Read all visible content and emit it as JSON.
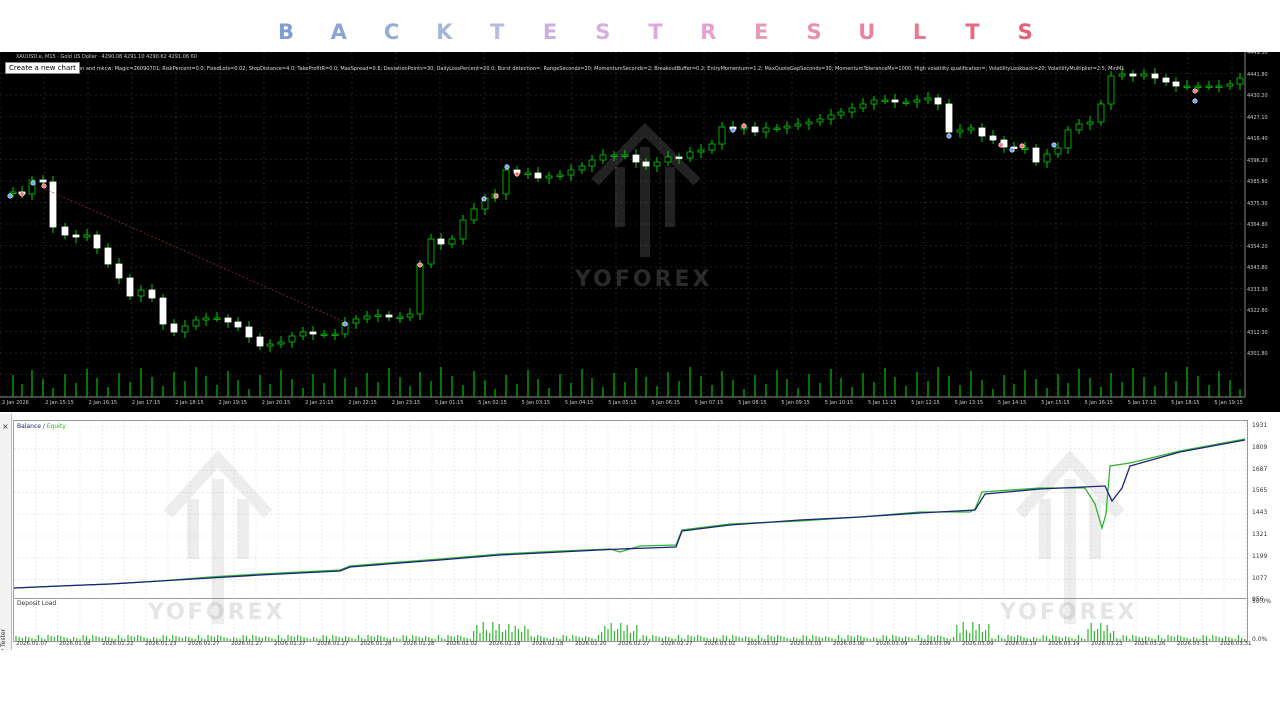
{
  "banner": {
    "letters": [
      "B",
      "A",
      "C",
      "K",
      "T",
      "E",
      "S",
      "T",
      "R",
      "E",
      "S",
      "U",
      "L",
      "T",
      "S"
    ],
    "colors": [
      "#7e9ed4",
      "#8aa4d6",
      "#95acd9",
      "#a6b5dc",
      "#b9b9e2",
      "#c8b0e0",
      "#d6aee0",
      "#e0a8d6",
      "#e6a2cc",
      "#e69ab8",
      "#e890ac",
      "#e8849e",
      "#e87890",
      "#e66c82",
      "#e46076"
    ]
  },
  "chart": {
    "header": "XAUUSD.e, M15 · Gold US Dollar · 4290.08 4291.10 4290.62 4291.06  60",
    "params": "on and mkcw; Magic=26090701; RiskPercent=0.0; FixedLots=0.02; StopDistance=4.0; TakeProfitR=0.0; MaxSpread=0.6; DeviationPoints=30; DailyLossPercent=20.0; Burst detection=; RangeSeconds=20; MomentumSeconds=2; BreakoutBuffer=0.2; EntryMomentum=1.2; MaxQuoteGapSeconds=30; MomentumToleranceMs=1000; High volatility qualification=; VolatilityLookback=20; VolatilityMultiplier=2.5; MinM1",
    "tooltip": "Create a new chart",
    "price_labels": [
      "4449.30",
      "4441.80",
      "4430.20",
      "4427.10",
      "4416.40",
      "4396.20",
      "4385.80",
      "4375.30",
      "4364.80",
      "4354.20",
      "4343.80",
      "4333.30",
      "4322.80",
      "4312.30",
      "4301.80"
    ],
    "time_labels": [
      "2 Jan 2026",
      "2 Jan 15:15",
      "2 Jan 16:15",
      "2 Jan 17:15",
      "2 Jan 18:15",
      "2 Jan 19:15",
      "2 Jan 20:15",
      "2 Jan 21:15",
      "2 Jan 22:15",
      "2 Jan 23:15",
      "5 Jan 01:15",
      "5 Jan 02:15",
      "5 Jan 03:15",
      "5 Jan 04:15",
      "5 Jan 05:15",
      "5 Jan 06:15",
      "5 Jan 07:15",
      "5 Jan 08:15",
      "5 Jan 09:15",
      "5 Jan 10:15",
      "5 Jan 11:15",
      "5 Jan 12:15",
      "5 Jan 13:15",
      "5 Jan 14:15",
      "5 Jan 15:15",
      "5 Jan 16:15",
      "5 Jan 17:15",
      "5 Jan 18:15",
      "5 Jan 19:15"
    ],
    "watermark": "YOFOREX",
    "colors": {
      "bull": "#ffffff",
      "bear": "#ffffff",
      "wick": "#00d000",
      "grid": "#3a3a3a",
      "volume": "#00c000"
    }
  },
  "tester": {
    "side_label": "Strategy Tester",
    "close_glyph": "×",
    "balance_legend": {
      "balance": "Balance",
      "sep": " / ",
      "equity": "Equity"
    },
    "deposit_title": "Deposit Load",
    "y_labels": [
      "1931",
      "1809",
      "1687",
      "1565",
      "1443",
      "1321",
      "1199",
      "1077",
      "956"
    ],
    "deposit_labels": [
      "50.0%",
      "0.0%"
    ],
    "date_labels": [
      "2026.01.07",
      "2026.01.08",
      "2026.01.22",
      "2026.01.23",
      "2026.01.27",
      "2026.01.27",
      "2026.01.27",
      "2026.01.27",
      "2026.01.28",
      "2026.01.28",
      "2026.02.02",
      "2026.02.18",
      "2026.02.18",
      "2026.02.20",
      "2026.02.27",
      "2026.02.27",
      "2026.03.02",
      "2026.03.02",
      "2026.03.03",
      "2026.03.06",
      "2026.03.09",
      "2026.03.09",
      "2026.03.09",
      "2026.03.19",
      "2026.03.19",
      "2026.03.23",
      "2026.03.26",
      "2026.03.31",
      "2026.03.31"
    ],
    "watermark": "YOFOREX",
    "colors": {
      "balance": "#1a237e",
      "equity": "#2db52d",
      "deposit": "#2db52d"
    }
  }
}
